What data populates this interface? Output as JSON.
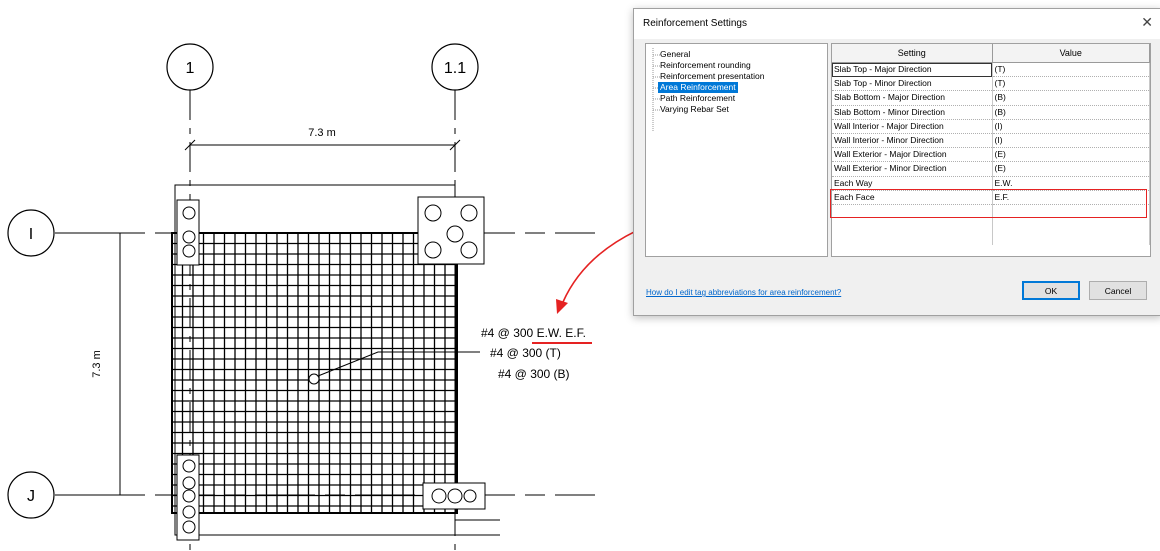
{
  "drawing": {
    "grids": {
      "col_1": "1",
      "col_1_1": "1.1",
      "row_i": "I",
      "row_j": "J"
    },
    "dimension_horizontal": "7.3 m",
    "dimension_vertical": "7.3 m",
    "tags": {
      "line1_prefix": "#4 @ 300 ",
      "line1_abbrev": "E.W. E.F.",
      "line2": "#4 @ 300 (T)",
      "line3": "#4 @ 300 (B)"
    }
  },
  "dialog": {
    "title": "Reinforcement Settings",
    "close_glyph": "✕",
    "tree": [
      {
        "label": "General",
        "selected": false
      },
      {
        "label": "Reinforcement rounding",
        "selected": false
      },
      {
        "label": "Reinforcement presentation",
        "selected": false
      },
      {
        "label": "Area Reinforcement",
        "selected": true
      },
      {
        "label": "Path Reinforcement",
        "selected": false
      },
      {
        "label": "Varying Rebar Set",
        "selected": false
      }
    ],
    "grid": {
      "headers": {
        "setting": "Setting",
        "value": "Value"
      },
      "rows": [
        {
          "setting": "Slab Top - Major Direction",
          "value": "(T)"
        },
        {
          "setting": "Slab Top - Minor Direction",
          "value": "(T)"
        },
        {
          "setting": "Slab Bottom - Major Direction",
          "value": "(B)"
        },
        {
          "setting": "Slab Bottom - Minor Direction",
          "value": "(B)"
        },
        {
          "setting": "Wall Interior - Major Direction",
          "value": "(I)"
        },
        {
          "setting": "Wall Interior - Minor Direction",
          "value": "(I)"
        },
        {
          "setting": "Wall Exterior - Major Direction",
          "value": "(E)"
        },
        {
          "setting": "Wall Exterior - Minor Direction",
          "value": "(E)"
        },
        {
          "setting": "Each Way",
          "value": "E.W."
        },
        {
          "setting": "Each Face",
          "value": "E.F."
        }
      ]
    },
    "help_link": "How do I edit tag abbreviations for area reinforcement?",
    "ok_label": "OK",
    "cancel_label": "Cancel"
  },
  "colors": {
    "highlight": "#e52222",
    "selection": "#0078d7",
    "link": "#0066cc"
  }
}
